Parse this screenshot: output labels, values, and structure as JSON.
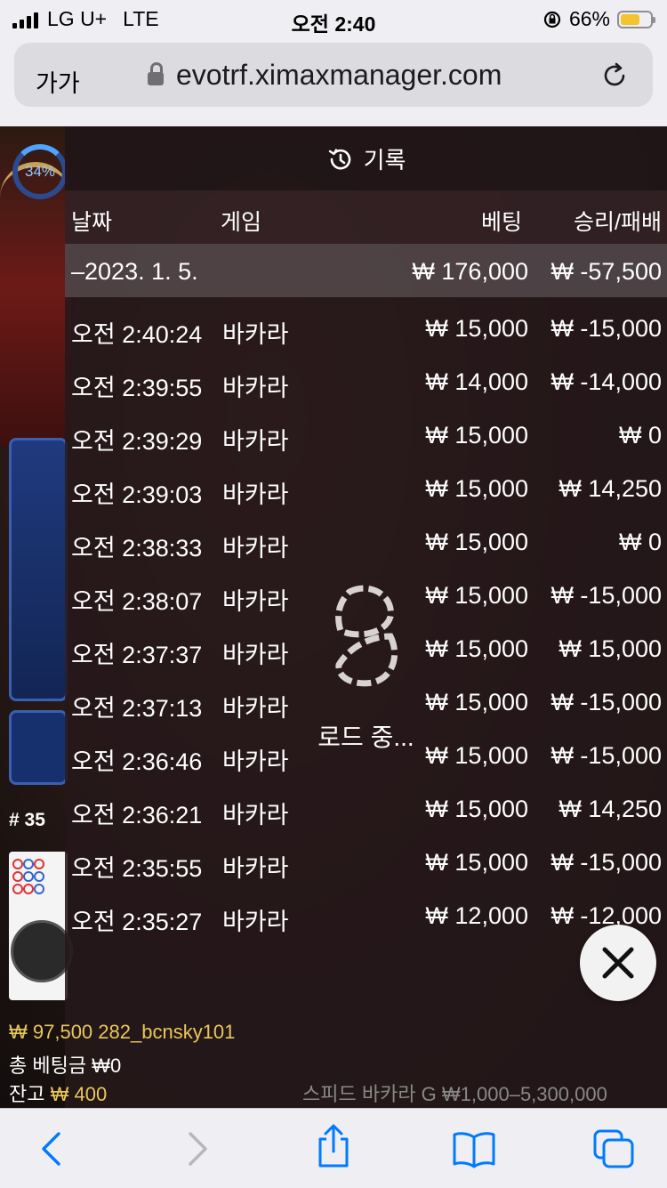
{
  "status_bar": {
    "carrier": "LG U+",
    "network": "LTE",
    "time": "오전 2:40",
    "battery": "66%",
    "battery_level": 0.66
  },
  "browser": {
    "text_size_label": "가가",
    "url": "evotrf.ximaxmanager.com"
  },
  "history": {
    "title": "기록",
    "columns": {
      "date": "날짜",
      "game": "게임",
      "bet": "베팅",
      "result": "승리/패배"
    },
    "summary": {
      "date": "–2023. 1. 5.",
      "bet": "₩ 176,000",
      "result": "₩ -57,500"
    },
    "rows": [
      {
        "time": "오전 2:40:24",
        "game": "바카라",
        "bet": "₩ 15,000",
        "result": "₩ -15,000"
      },
      {
        "time": "오전 2:39:55",
        "game": "바카라",
        "bet": "₩ 14,000",
        "result": "₩ -14,000"
      },
      {
        "time": "오전 2:39:29",
        "game": "바카라",
        "bet": "₩ 15,000",
        "result": "₩ 0"
      },
      {
        "time": "오전 2:39:03",
        "game": "바카라",
        "bet": "₩ 15,000",
        "result": "₩ 14,250"
      },
      {
        "time": "오전 2:38:33",
        "game": "바카라",
        "bet": "₩ 15,000",
        "result": "₩ 0"
      },
      {
        "time": "오전 2:38:07",
        "game": "바카라",
        "bet": "₩ 15,000",
        "result": "₩ -15,000"
      },
      {
        "time": "오전 2:37:37",
        "game": "바카라",
        "bet": "₩ 15,000",
        "result": "₩ 15,000"
      },
      {
        "time": "오전 2:37:13",
        "game": "바카라",
        "bet": "₩ 15,000",
        "result": "₩ -15,000"
      },
      {
        "time": "오전 2:36:46",
        "game": "바카라",
        "bet": "₩ 15,000",
        "result": "₩ -15,000"
      },
      {
        "time": "오전 2:36:21",
        "game": "바카라",
        "bet": "₩ 15,000",
        "result": "₩ 14,250"
      },
      {
        "time": "오전 2:35:55",
        "game": "바카라",
        "bet": "₩ 15,000",
        "result": "₩ -15,000"
      },
      {
        "time": "오전 2:35:27",
        "game": "바카라",
        "bet": "₩ 12,000",
        "result": "₩ -12,000"
      }
    ],
    "loading_text": "로드 중..."
  },
  "game_background": {
    "player_percent": "34%",
    "round_number": "# 35",
    "balance_line": "₩ 97,500 282_bcnsky101",
    "total_bet_line": "총 베팅금 ₩0",
    "remaining_label": "잔고",
    "remaining_value": "₩ 400",
    "table_info": "스피드 바카라 G ₩1,000–5,300,000"
  },
  "colors": {
    "overlay": "#26181a",
    "accent_blue": "#007aff",
    "gold": "#e9c75a"
  },
  "icons": [
    "history-icon",
    "lock-icon",
    "reload-icon",
    "close-icon",
    "back-icon",
    "forward-icon",
    "share-icon",
    "bookmarks-icon",
    "tabs-icon"
  ]
}
